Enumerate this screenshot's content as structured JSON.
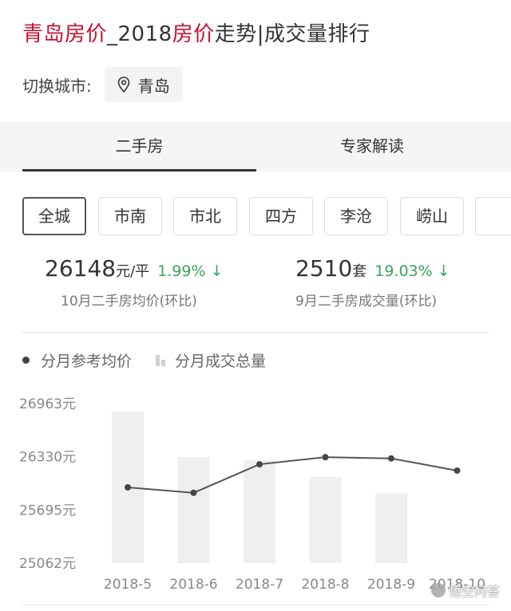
{
  "header": {
    "title_red_1": "青岛房价",
    "title_mid": "_2018",
    "title_red_2": "房价",
    "title_rest": "走势|成交量排行"
  },
  "city": {
    "label": "切换城市:",
    "current": "青岛",
    "icon": "location-pin-icon"
  },
  "tabs": [
    {
      "label": "二手房",
      "active": true
    },
    {
      "label": "专家解读",
      "active": false
    }
  ],
  "districts": [
    "全城",
    "市南",
    "市北",
    "四方",
    "李沧",
    "崂山"
  ],
  "stats": {
    "price": {
      "value": "26148",
      "unit": "元/平",
      "change": "1.99%",
      "arrow": "↓",
      "caption": "10月二手房均价(环比)"
    },
    "volume": {
      "value": "2510",
      "unit": "套",
      "change": "19.03%",
      "arrow": "↓",
      "caption": "9月二手房成交量(环比)"
    }
  },
  "legend": {
    "line_label": "分月参考均价",
    "bar_label": "分月成交总量"
  },
  "colors": {
    "accent_red": "#c8102e",
    "down_green": "#3aa35b",
    "bar_gray": "#efefef",
    "line": "#555555"
  },
  "watermark": "悟空问答",
  "chart_data": {
    "type": "bar+line",
    "categories": [
      "2018-5",
      "2018-6",
      "2018-7",
      "2018-8",
      "2018-9",
      "2018-10"
    ],
    "y_ticks": [
      "26963元",
      "26330元",
      "25695元",
      "25062元"
    ],
    "ylim": [
      25062,
      26963
    ],
    "series": [
      {
        "name": "分月参考均价",
        "type": "line",
        "values": [
          25965,
          25900,
          26240,
          26325,
          26310,
          26165
        ]
      },
      {
        "name": "分月成交总量",
        "type": "bar",
        "relative_heights": [
          1.0,
          0.7,
          0.68,
          0.57,
          0.46,
          null
        ]
      }
    ]
  }
}
